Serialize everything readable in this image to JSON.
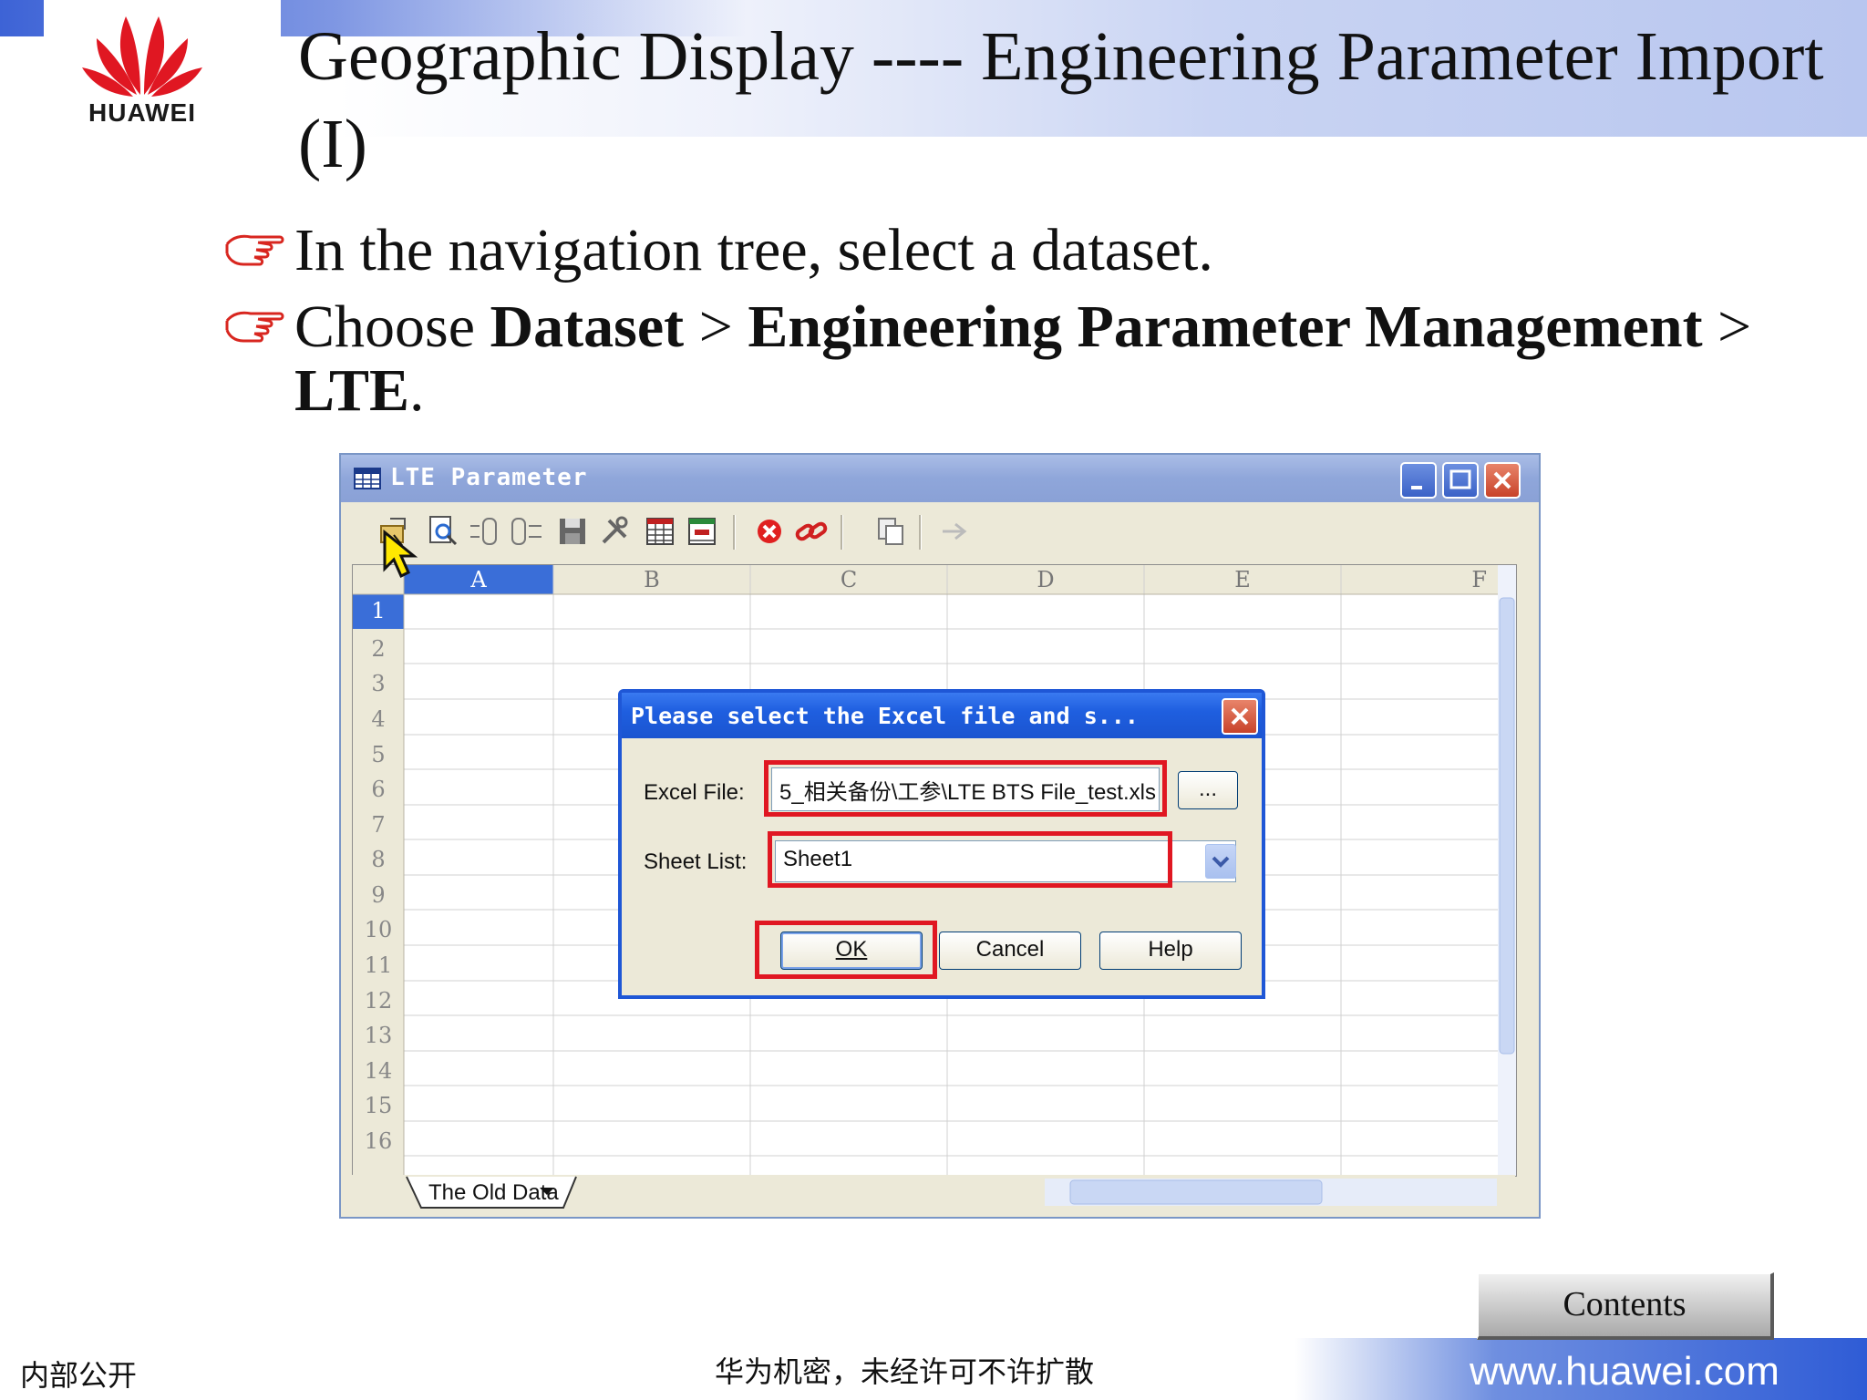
{
  "brand": {
    "name": "HUAWEI",
    "url": "www.huawei.com",
    "red": "#e01722",
    "blue": "#2f5cd6"
  },
  "slide": {
    "title": "Geographic Display ---- Engineering Parameter Import (I)",
    "bullets": [
      {
        "plain": "In the navigation tree, select a dataset."
      },
      {
        "prefix": "Choose ",
        "b1": "Dataset",
        "sep1": " > ",
        "b2": "Engineering Parameter Management",
        "sep2": " > ",
        "b3": "LTE",
        "suffix": "."
      }
    ]
  },
  "window": {
    "title": "LTE Parameter",
    "toolbar_icons": [
      "import-icon",
      "search-icon",
      "insert-row-icon",
      "insert-column-icon",
      "save-icon",
      "tools-icon",
      "table-icon",
      "grid-icon",
      "delete-icon",
      "link-icon",
      "copy-icon",
      "arrow-icon"
    ],
    "columns": [
      "A",
      "B",
      "C",
      "D",
      "E",
      "F"
    ],
    "rows": [
      "1",
      "2",
      "3",
      "4",
      "5",
      "6",
      "7",
      "8",
      "9",
      "10",
      "11",
      "12",
      "13",
      "14",
      "15",
      "16"
    ],
    "sheet_tab": "The Old Data"
  },
  "dialog": {
    "title": "Please select the Excel file and s...",
    "excel_label": "Excel File:",
    "excel_value": "5_相关备份\\工参\\LTE BTS File_test.xls",
    "browse_label": "...",
    "sheet_label": "Sheet List:",
    "sheet_value": "Sheet1",
    "ok": "OK",
    "cancel": "Cancel",
    "help": "Help"
  },
  "footer": {
    "contents": "Contents",
    "left": "内部公开",
    "center": "华为机密，未经许可不许扩散"
  }
}
